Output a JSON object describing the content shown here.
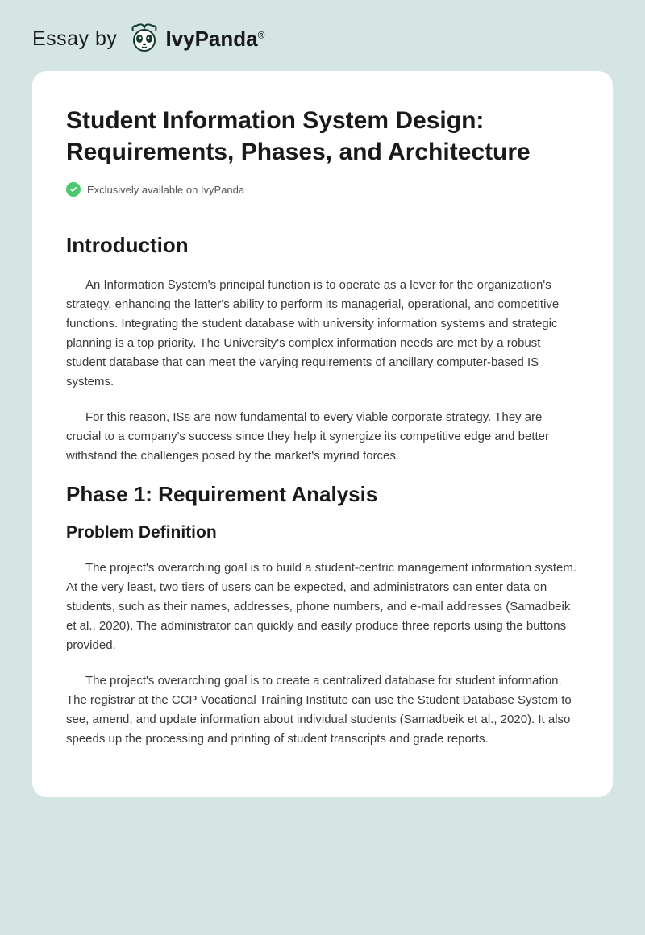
{
  "header": {
    "essay_by": "Essay by",
    "brand": "IvyPanda",
    "reg": "®"
  },
  "document": {
    "title": "Student Information System Design: Requirements, Phases, and Architecture",
    "exclusive_badge": "Exclusively available on IvyPanda",
    "sections": {
      "intro_heading": "Introduction",
      "intro_p1": "An Information System's principal function is to operate as a lever for the organization's strategy, enhancing the latter's ability to perform its managerial, operational, and competitive functions. Integrating the student database with university information systems and strategic planning is a top priority. The University's complex information needs are met by a robust student database that can meet the varying requirements of ancillary computer-based IS systems.",
      "intro_p2": "For this reason, ISs are now fundamental to every viable corporate strategy. They are crucial to a company's success since they help it synergize its competitive edge and better withstand the challenges posed by the market's myriad forces.",
      "phase1_heading": "Phase 1: Requirement Analysis",
      "problem_def_heading": "Problem Definition",
      "problem_p1": "The project's overarching goal is to build a student-centric management information system. At the very least, two tiers of users can be expected, and administrators can enter data on students, such as their names, addresses, phone numbers, and e-mail addresses (Samadbeik et al., 2020). The administrator can quickly and easily produce three reports using the buttons provided.",
      "problem_p2": "The project's overarching goal is to create a centralized database for student information. The registrar at the CCP Vocational Training Institute can use the Student Database System to see, amend, and update information about individual students (Samadbeik et al., 2020). It also speeds up the processing and printing of student transcripts and grade reports."
    }
  }
}
